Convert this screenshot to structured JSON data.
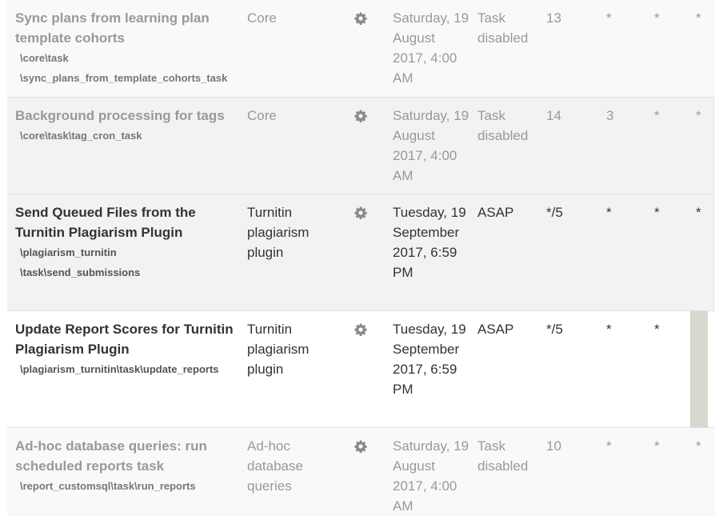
{
  "rows": [
    {
      "title": "Sync plans from learning plan template cohorts",
      "path_lines": [
        "\\core\\task",
        "\\sync_plans_from_template_cohorts_task"
      ],
      "component": "Core",
      "next_run": "Saturday, 19 August 2017, 4:00 AM",
      "last_run": "Task disabled",
      "minute": "13",
      "hour": "*",
      "day": "*",
      "month": "*",
      "disabled": true
    },
    {
      "title": "Background processing for tags",
      "path_lines": [
        "\\core\\task\\tag_cron_task"
      ],
      "component": "Core",
      "next_run": "Saturday, 19 August 2017, 4:00 AM",
      "last_run": "Task disabled",
      "minute": "14",
      "hour": "3",
      "day": "*",
      "month": "*",
      "disabled": true
    },
    {
      "title": "Send Queued Files from the Turnitin Plagiarism Plugin",
      "path_lines": [
        "\\plagiarism_turnitin",
        "\\task\\send_submissions"
      ],
      "component": "Turnitin plagiarism plugin",
      "next_run": "Tuesday, 19 September 2017, 6:59 PM",
      "last_run": "ASAP",
      "minute": "*/5",
      "hour": "*",
      "day": "*",
      "month": "*",
      "disabled": false
    },
    {
      "title": "Update Report Scores for Turnitin Plagiarism Plugin",
      "path_lines": [
        "\\plagiarism_turnitin\\task\\update_reports"
      ],
      "component": "Turnitin plagiarism plugin",
      "next_run": "Tuesday, 19 September 2017, 6:59 PM",
      "last_run": "ASAP",
      "minute": "*/5",
      "hour": "*",
      "day": "*",
      "month": "*",
      "disabled": false
    },
    {
      "title": "Ad-hoc database queries: run scheduled reports task",
      "path_lines": [
        "\\report_customsql\\task\\run_reports"
      ],
      "component": "Ad-hoc database queries",
      "next_run": "Saturday, 19 August 2017, 4:00 AM",
      "last_run": "Task disabled",
      "minute": "10",
      "hour": "*",
      "day": "*",
      "month": "*",
      "disabled": true
    }
  ],
  "icons": {
    "edit": "gear-icon"
  }
}
